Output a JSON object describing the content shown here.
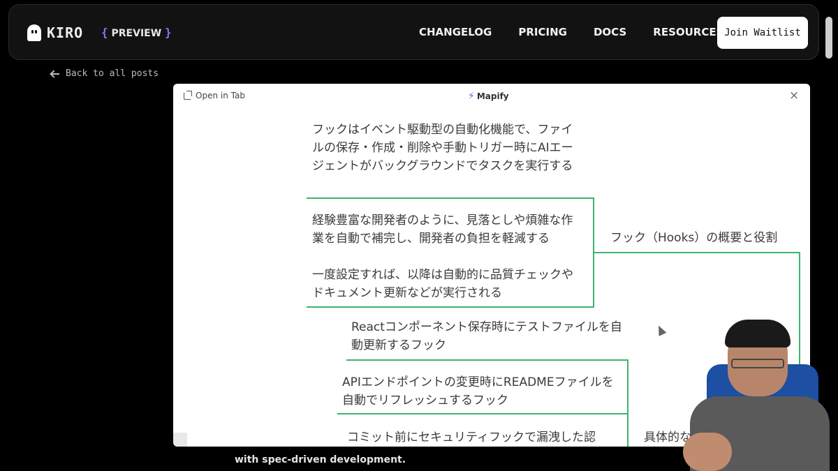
{
  "nav": {
    "logo_text": "KIRO",
    "badge_open": "{",
    "badge_label": "PREVIEW",
    "badge_close": "}",
    "links": [
      "CHANGELOG",
      "PRICING",
      "DOCS",
      "RESOURCES"
    ],
    "join_label": "Join Waitlist"
  },
  "back_link": "Back to all posts",
  "background_article": {
    "footer_text": "with spec-driven development."
  },
  "modal": {
    "open_in_tab": "Open in Tab",
    "brand": "Mapify",
    "close": "×",
    "nodes": [
      "フックはイベント駆動型の自動化機能で、ファイルの保存・作成・削除や手動トリガー時にAIエージェントがバックグラウンドでタスクを実行する",
      "経験豊富な開発者のように、見落としや煩雑な作業を自動で補完し、開発者の負担を軽減する",
      "一度設定すれば、以降は自動的に品質チェックやドキュメント更新などが実行される",
      "Reactコンポーネント保存時にテストファイルを自動更新するフック",
      "APIエンドポイントの変更時にREADMEファイルを自動でリフレッシュするフック",
      "コミット前にセキュリティフックで漏洩した認"
    ],
    "branch_label": "フック（Hooks）の概要と役割",
    "branch_label_2": "具体的な"
  },
  "colors": {
    "accent_purple": "#9b6bff",
    "mindmap_line": "#3cb371"
  }
}
